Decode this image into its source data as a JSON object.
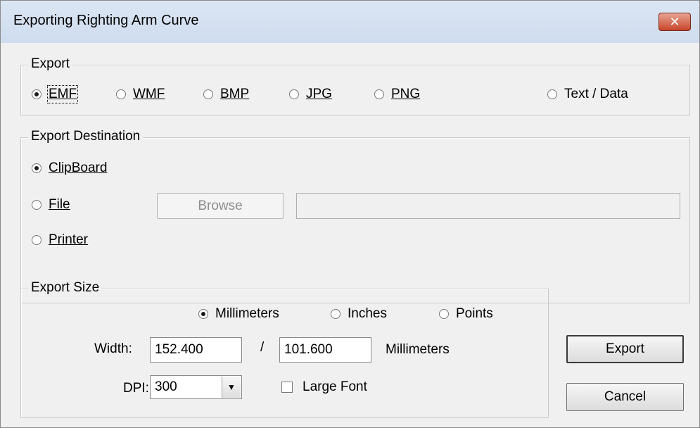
{
  "window": {
    "title": "Exporting Righting Arm Curve",
    "close_glyph": "✕"
  },
  "export_group": {
    "legend": "Export",
    "formats": [
      {
        "label": "EMF",
        "selected": true
      },
      {
        "label": "WMF",
        "selected": false
      },
      {
        "label": "BMP",
        "selected": false
      },
      {
        "label": "JPG",
        "selected": false
      },
      {
        "label": "PNG",
        "selected": false
      },
      {
        "label": "Text / Data",
        "selected": false
      }
    ]
  },
  "destination_group": {
    "legend": "Export Destination",
    "options": [
      {
        "label": "ClipBoard",
        "selected": true
      },
      {
        "label": "File",
        "selected": false
      },
      {
        "label": "Printer",
        "selected": false
      }
    ],
    "browse_label": "Browse",
    "file_path": ""
  },
  "size_group": {
    "legend": "Export Size",
    "units": [
      {
        "label": "Millimeters",
        "selected": true
      },
      {
        "label": "Inches",
        "selected": false
      },
      {
        "label": "Points",
        "selected": false
      }
    ],
    "width_label": "Width:",
    "width_value": "152.400",
    "separator": "/",
    "height_value": "101.600",
    "unit_label": "Millimeters",
    "dpi_label": "DPI:",
    "dpi_value": "300",
    "large_font_label": "Large Font",
    "large_font_checked": false
  },
  "buttons": {
    "export": "Export",
    "cancel": "Cancel"
  }
}
